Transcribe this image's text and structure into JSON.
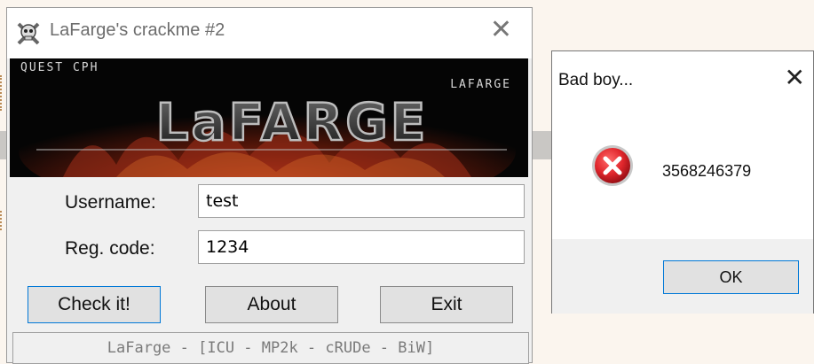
{
  "main_window": {
    "title": "LaFarge's crackme #2",
    "close_glyph": "✕",
    "icon": "skull-crossbones-icon",
    "banner": {
      "top_left_text": "QUEST CPH",
      "top_right_text": "LAFARGE",
      "logo_text": "LaFARGE"
    },
    "username_label": "Username:",
    "username_value": "test",
    "regcode_label": "Reg. code:",
    "regcode_value": "1234",
    "buttons": {
      "check": "Check it!",
      "about": "About",
      "exit": "Exit"
    },
    "status_text": "LaFarge - [ICU - MP2k - cRUDe - BiW]"
  },
  "message_box": {
    "title": "Bad boy...",
    "close_glyph": "✕",
    "icon": "error-icon",
    "message": "3568246379",
    "ok_label": "OK",
    "colors": {
      "error_red": "#e0262c",
      "accent_blue": "#0078d7"
    }
  }
}
